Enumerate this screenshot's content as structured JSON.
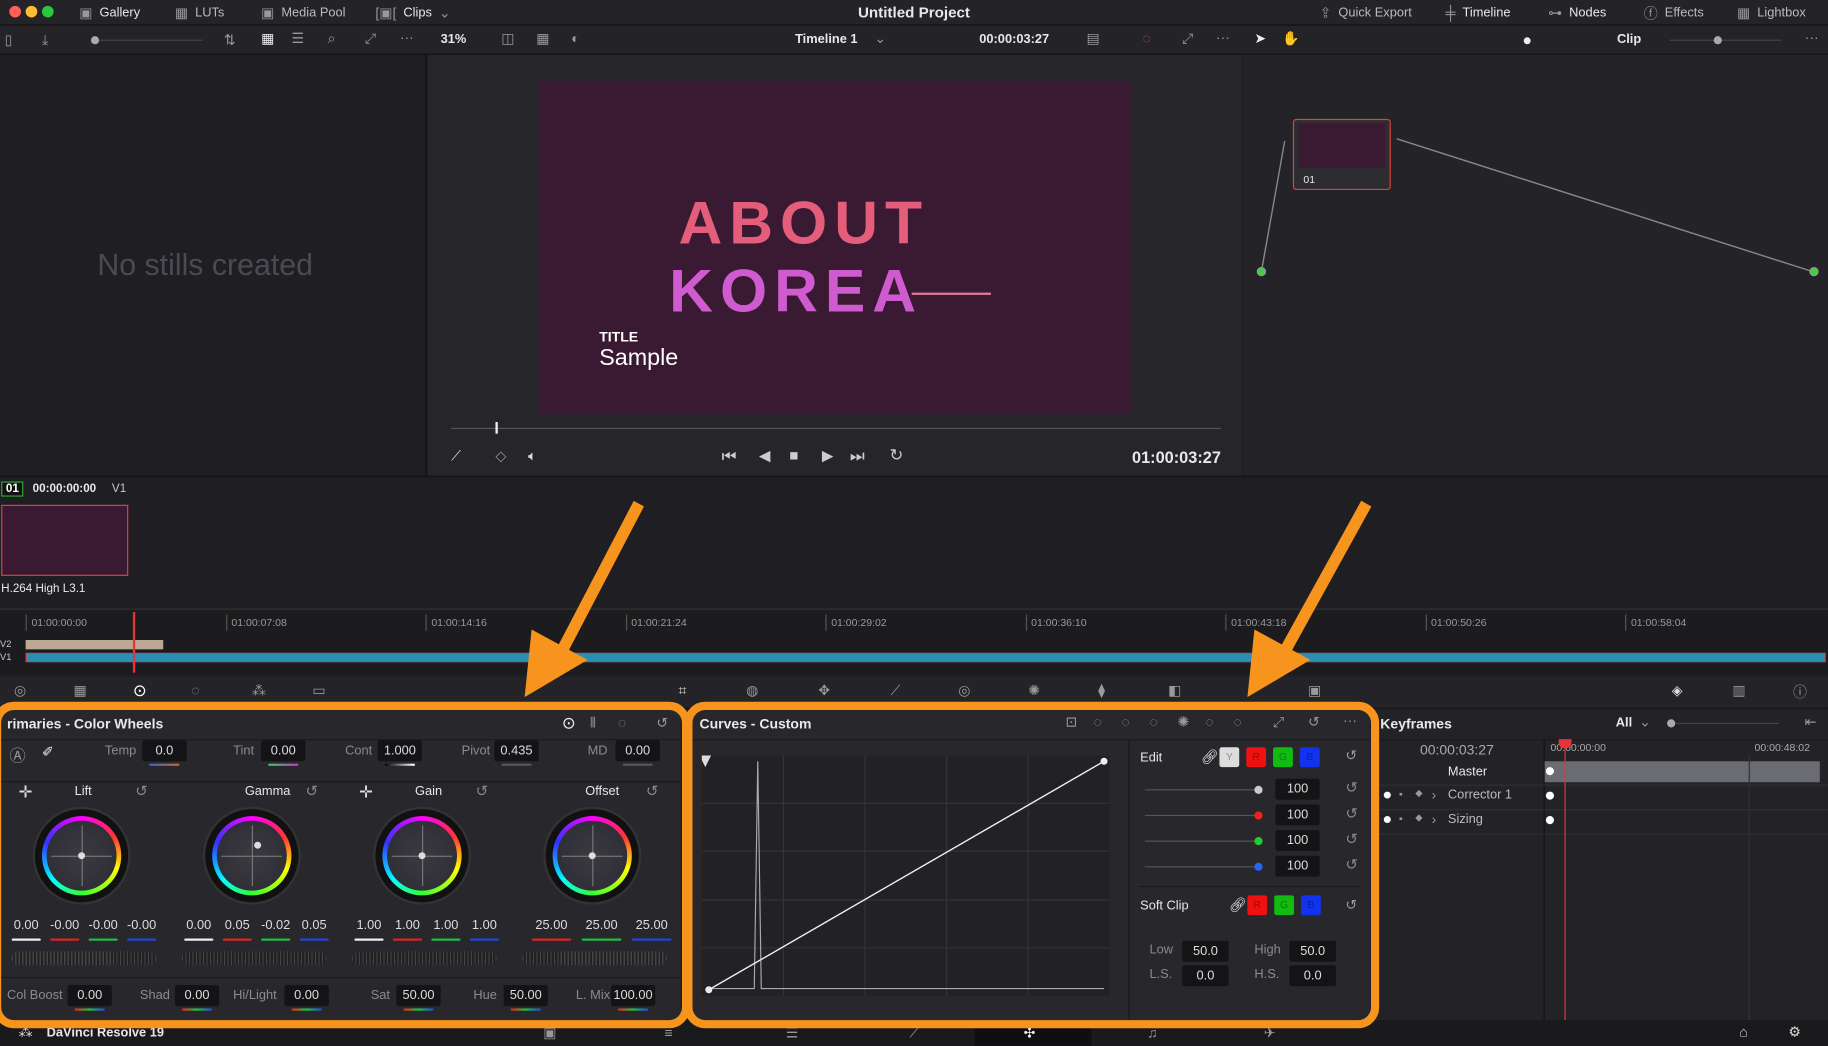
{
  "window": {
    "title": "Untitled Project",
    "traffic_lights": [
      "#ff5f57",
      "#febc2e",
      "#28c840"
    ]
  },
  "top_tabs": [
    {
      "label": "Gallery",
      "icon": "gallery-icon"
    },
    {
      "label": "LUTs",
      "icon": "luts-icon"
    },
    {
      "label": "Media Pool",
      "icon": "media-pool-icon"
    },
    {
      "label": "Clips",
      "icon": "clips-icon"
    }
  ],
  "right_tabs": [
    {
      "label": "Quick Export",
      "icon": "export-icon"
    },
    {
      "label": "Timeline",
      "icon": "timeline-icon"
    },
    {
      "label": "Nodes",
      "icon": "nodes-icon"
    },
    {
      "label": "Effects",
      "icon": "fx-icon"
    },
    {
      "label": "Lightbox",
      "icon": "lightbox-icon"
    }
  ],
  "toolbar": {
    "zoom": "31%",
    "timeline_name": "Timeline 1",
    "timecode": "00:00:03:27",
    "node_mode": "Clip"
  },
  "gallery": {
    "empty_text": "No stills created"
  },
  "viewer": {
    "title_line1": "ABOUT",
    "title_line2": "KOREA",
    "caption_small": "TITLE",
    "caption_large": "Sample",
    "timecode": "01:00:03:27"
  },
  "node": {
    "label": "01"
  },
  "clip": {
    "number": "01",
    "timecode": "00:00:00:00",
    "track": "V1",
    "codec": "H.264 High L3.1"
  },
  "timeline": {
    "ticks": [
      "01:00:00:00",
      "01:00:07:08",
      "01:00:14:16",
      "01:00:21:24",
      "01:00:29:02",
      "01:00:36:10",
      "01:00:43:18",
      "01:00:50:26",
      "01:00:58:04"
    ],
    "tracks": [
      "V2",
      "V1"
    ]
  },
  "primaries": {
    "title": "rimaries - Color Wheels",
    "top": [
      {
        "label": "Temp",
        "value": "0.0"
      },
      {
        "label": "Tint",
        "value": "0.00"
      },
      {
        "label": "Cont",
        "value": "1.000"
      },
      {
        "label": "Pivot",
        "value": "0.435"
      },
      {
        "label": "MD",
        "value": "0.00"
      }
    ],
    "wheels": [
      {
        "label": "Lift",
        "values": [
          "0.00",
          "-0.00",
          "-0.00",
          "-0.00"
        ]
      },
      {
        "label": "Gamma",
        "values": [
          "0.00",
          "0.05",
          "-0.02",
          "0.05"
        ]
      },
      {
        "label": "Gain",
        "values": [
          "1.00",
          "1.00",
          "1.00",
          "1.00"
        ]
      },
      {
        "label": "Offset",
        "values": [
          "25.00",
          "25.00",
          "25.00"
        ]
      }
    ],
    "bottom": [
      {
        "label": "Col Boost",
        "value": "0.00"
      },
      {
        "label": "Shad",
        "value": "0.00"
      },
      {
        "label": "Hi/Light",
        "value": "0.00"
      },
      {
        "label": "Sat",
        "value": "50.00"
      },
      {
        "label": "Hue",
        "value": "50.00"
      },
      {
        "label": "L. Mix",
        "value": "100.00"
      }
    ]
  },
  "curves": {
    "title": "Curves - Custom",
    "edit_label": "Edit",
    "channels": [
      "Y",
      "R",
      "G",
      "B"
    ],
    "intensity": [
      "100",
      "100",
      "100",
      "100"
    ],
    "soft_clip_label": "Soft Clip",
    "soft_clip": [
      {
        "label": "Low",
        "value": "50.0"
      },
      {
        "label": "High",
        "value": "50.0"
      },
      {
        "label": "L.S.",
        "value": "0.0"
      },
      {
        "label": "H.S.",
        "value": "0.0"
      }
    ]
  },
  "keyframes": {
    "title": "Keyframes",
    "filter": "All",
    "timecode": "00:00:03:27",
    "ruler": [
      "00:00:00:00",
      "00:00:48:02"
    ],
    "rows": [
      "Master",
      "Corrector 1",
      "Sizing"
    ]
  },
  "footer": {
    "app": "DaVinci Resolve 19"
  },
  "colors": {
    "accent_orange": "#f7941d",
    "playhead": "#e8333a",
    "track_v1": "#2a8fb5"
  }
}
